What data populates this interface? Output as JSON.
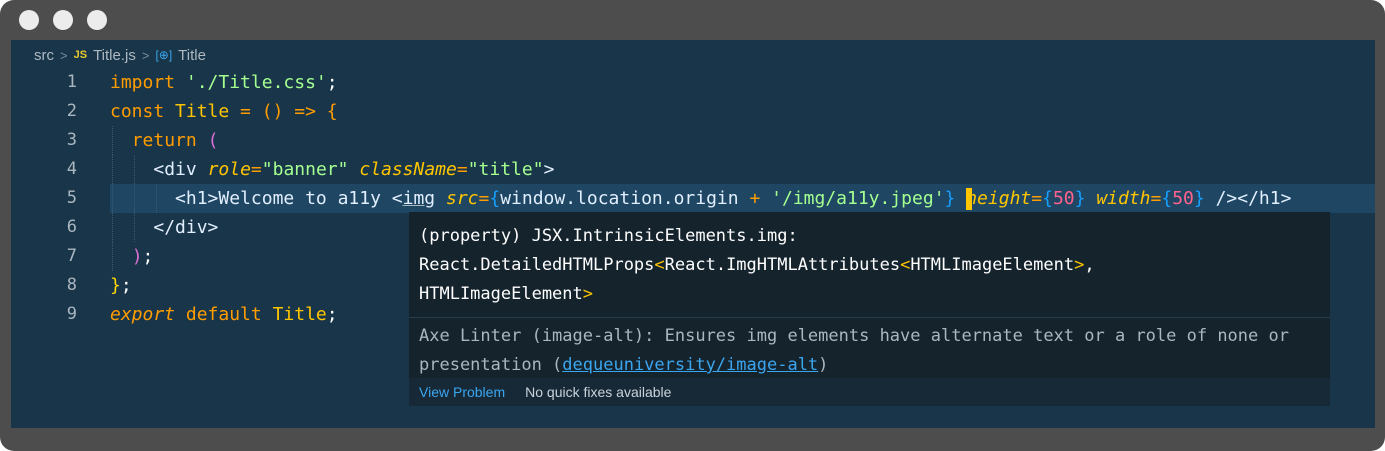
{
  "breadcrumb": {
    "root": "src",
    "file_badge": "JS",
    "file": "Title.js",
    "symbol_icon": "[⊕]",
    "symbol": "Title"
  },
  "line_numbers": [
    "1",
    "2",
    "3",
    "4",
    "5",
    "6",
    "7",
    "8",
    "9"
  ],
  "code": {
    "l1": {
      "kw": "import",
      "str": "'./Title.css'",
      "semi": ";"
    },
    "l2": {
      "kw": "const",
      "name": "Title",
      "rest": " = () => {"
    },
    "l3": {
      "kw": "return",
      "paren": "("
    },
    "l4": {
      "open": "<div",
      "attr1": "role",
      "val1": "\"banner\"",
      "attr2": "className",
      "val2": "\"title\"",
      "close": ">"
    },
    "l5": {
      "h1": "<h1>",
      "text": "Welcome to a11y ",
      "lt": "<",
      "img": "img",
      "src_attr": "src",
      "expr": "window.location.origin",
      "plus": "+",
      "path": "'/img/a11y.jpeg'",
      "h_attr": "height",
      "h_val": "50",
      "w_attr": "width",
      "w_val": "50",
      "end": "/></h1>"
    },
    "l6": {
      "close": "</div>"
    },
    "l7": {
      "paren": ")",
      "semi": ";"
    },
    "l8": {
      "brace": "}",
      "semi": ";"
    },
    "l9": {
      "kw": "export",
      "kw2": "default",
      "name": "Title",
      "semi": ";"
    }
  },
  "hover": {
    "sig1": "(property) JSX.IntrinsicElements.img:",
    "sig2a": "React.DetailedHTMLProps",
    "sig2b": "React.ImgHTMLAttributes",
    "sig2c": "HTMLImageElement",
    "sig2d": ",",
    "sig3": "HTMLImageElement",
    "desc": "Axe Linter (image-alt): Ensures img elements have alternate text or a role of none or presentation (",
    "link": "dequeuniversity/image-alt",
    "desc_end": ")",
    "view_problem": "View Problem",
    "no_fixes": "No quick fixes available"
  },
  "colors": {
    "frame": "#4d4d4d",
    "editor_bg": "#193549",
    "highlight_line": "#1f4662",
    "keyword": "#ff9d00",
    "string": "#a5ff90",
    "identifier": "#ffc600",
    "number": "#ff628c",
    "link": "#3ba6f0"
  }
}
